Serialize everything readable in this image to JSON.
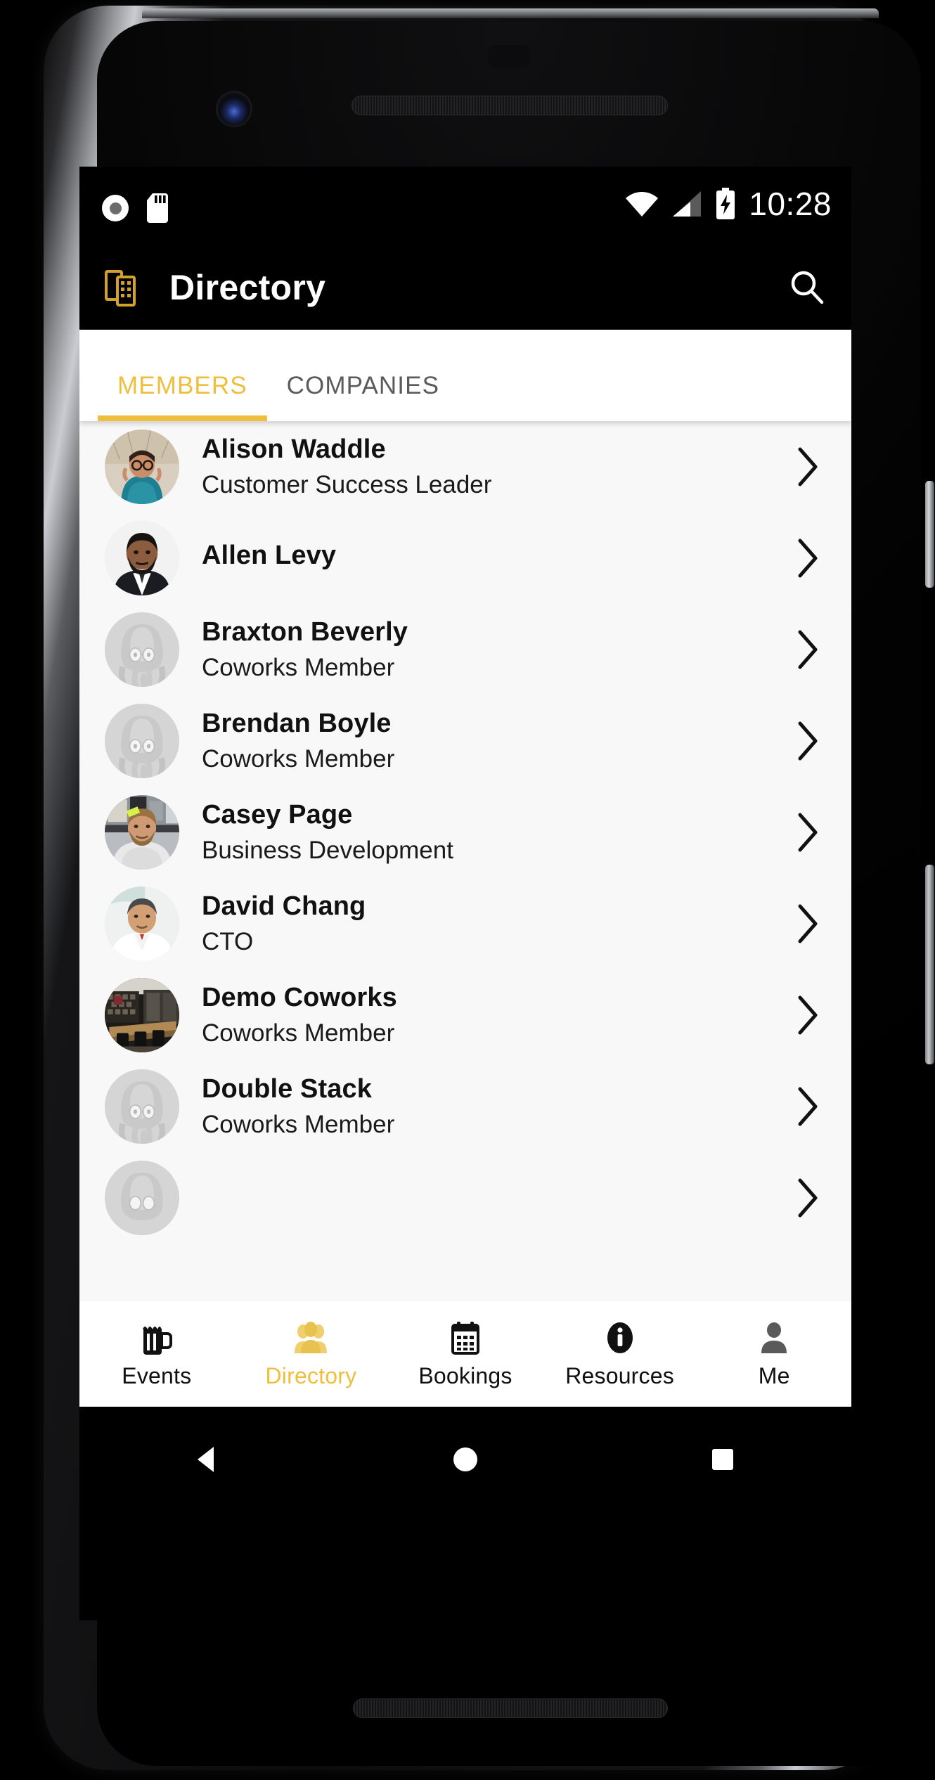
{
  "device": {
    "frame_name": "android-phone-frame",
    "accent_color": "#efbe3d",
    "screen_bg": "#f8f8f8"
  },
  "status_bar": {
    "time": "10:28",
    "icons": [
      "screen-record-icon",
      "sd-card-icon",
      "wifi-icon",
      "cellular-signal-icon",
      "battery-charging-icon"
    ]
  },
  "app_bar": {
    "logo_icon": "buildings-icon",
    "title": "Directory",
    "search_icon": "search-icon"
  },
  "tabs": {
    "active_index": 0,
    "items": [
      {
        "label": "MEMBERS"
      },
      {
        "label": "COMPANIES"
      }
    ]
  },
  "directory": {
    "chevron_icon": "chevron-right-icon",
    "members": [
      {
        "name": "Alison Waddle",
        "subtitle": "Customer Success Leader",
        "avatar": "photo-woman-glasses-teal"
      },
      {
        "name": "Allen Levy",
        "subtitle": "",
        "avatar": "photo-man-beard-suit"
      },
      {
        "name": "Braxton Beverly",
        "subtitle": "Coworks Member",
        "avatar": "default-octopus-avatar"
      },
      {
        "name": "Brendan Boyle",
        "subtitle": "Coworks Member",
        "avatar": "default-octopus-avatar"
      },
      {
        "name": "Casey Page",
        "subtitle": "Business Development",
        "avatar": "photo-man-desk"
      },
      {
        "name": "David Chang",
        "subtitle": "CTO",
        "avatar": "photo-man-white-shirt"
      },
      {
        "name": "Demo Coworks",
        "subtitle": "Coworks Member",
        "avatar": "photo-office-interior"
      },
      {
        "name": "Double Stack",
        "subtitle": "Coworks Member",
        "avatar": "default-octopus-avatar"
      },
      {
        "name": "",
        "subtitle": "",
        "avatar": "default-octopus-avatar"
      }
    ]
  },
  "bottom_nav": {
    "active_index": 1,
    "items": [
      {
        "label": "Events",
        "icon": "beer-mug-icon"
      },
      {
        "label": "Directory",
        "icon": "people-icon"
      },
      {
        "label": "Bookings",
        "icon": "calendar-icon"
      },
      {
        "label": "Resources",
        "icon": "info-circle-icon"
      },
      {
        "label": "Me",
        "icon": "person-icon"
      }
    ]
  },
  "android_nav": {
    "back_label": "Back",
    "home_label": "Home",
    "recents_label": "Recents"
  }
}
